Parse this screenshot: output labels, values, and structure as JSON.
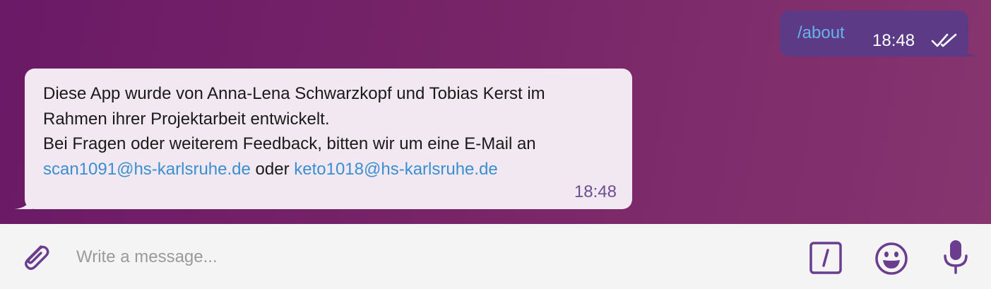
{
  "messages": {
    "outgoing": {
      "text": "/about",
      "time": "18:48",
      "status_icon": "double-check-icon"
    },
    "incoming": {
      "line1": "Diese App wurde von Anna-Lena Schwarzkopf und Tobias Kerst im",
      "line2": "Rahmen ihrer Projektarbeit entwickelt.",
      "line3": "Bei Fragen oder weiterem Feedback, bitten wir um eine E-Mail an",
      "email1": "scan1091@hs-karlsruhe.de",
      "connector": " oder ",
      "email2": "keto1018@hs-karlsruhe.de",
      "time": "18:48"
    }
  },
  "composer": {
    "placeholder": "Write a message...",
    "value": "",
    "icons": {
      "attach": "paperclip-icon",
      "commands": "slash-command-icon",
      "emoji": "emoji-icon",
      "voice": "microphone-icon"
    }
  },
  "colors": {
    "chat_background": "#772468",
    "outgoing_bubble": "#5c3a86",
    "incoming_bubble": "#f1e8f1",
    "link": "#3b8fd0",
    "accent_icon": "#6b3d8f",
    "composer_background": "#f4f4f4"
  }
}
